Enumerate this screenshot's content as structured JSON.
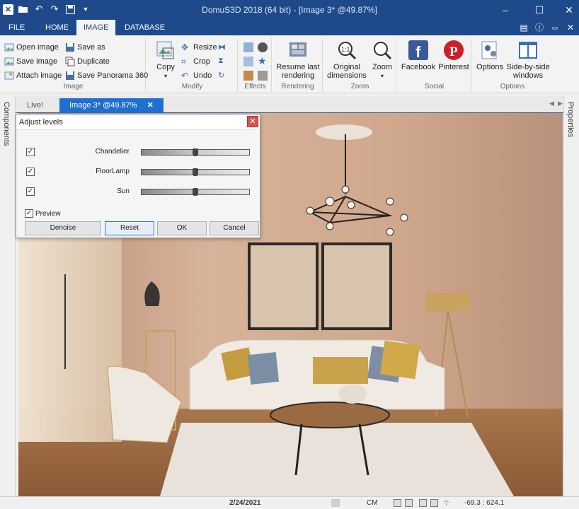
{
  "window": {
    "title": "DomuS3D 2018 (64 bit) - [Image 3* @49.87%]"
  },
  "ribbon_tabs": [
    {
      "label": "FILE"
    },
    {
      "label": "HOME"
    },
    {
      "label": "IMAGE"
    },
    {
      "label": "DATABASE"
    }
  ],
  "ribbon": {
    "image_group": {
      "label": "Image",
      "open_image": "Open image",
      "save_image": "Save image",
      "attach_image": "Attach image",
      "save_as": "Save as",
      "duplicate": "Duplicate",
      "save_panorama": "Save Panorama 360"
    },
    "modify_group": {
      "label": "Modify",
      "copy": "Copy",
      "resize": "Resize",
      "crop": "Crop",
      "undo": "Undo"
    },
    "effects_group": {
      "label": "Effects"
    },
    "rendering_group": {
      "label": "Rendering",
      "resume": "Resume last rendering"
    },
    "zoom_group": {
      "label": "Zoom",
      "original": "Original dimensions",
      "zoom": "Zoom"
    },
    "social_group": {
      "label": "Social",
      "facebook": "Facebook",
      "pinterest": "Pinterest"
    },
    "options_group": {
      "label": "Options",
      "options": "Options",
      "side_by_side": "Side-by-side windows"
    }
  },
  "side_panels": {
    "left": "Components",
    "right": "Properties"
  },
  "doc_tabs": [
    {
      "label": "Live!"
    },
    {
      "label": "Image 3* @49.87%"
    }
  ],
  "dialog": {
    "title": "Adjust levels",
    "lights": [
      {
        "name": "Chandelier",
        "checked": true,
        "level": 0.5
      },
      {
        "name": "FloorLamp",
        "checked": true,
        "level": 0.5
      },
      {
        "name": "Sun",
        "checked": true,
        "level": 0.5
      }
    ],
    "preview_label": "Preview",
    "preview_checked": true,
    "buttons": {
      "denoise": "Denoise",
      "reset": "Reset",
      "ok": "OK",
      "cancel": "Cancel"
    }
  },
  "statusbar": {
    "date": "2/24/2021",
    "unit": "CM",
    "coords": "-69.3 : 624.1"
  },
  "colors": {
    "title_bar": "#1e4a8c",
    "active_doc_tab": "#1e6fd0",
    "wall": "#c9a58b"
  }
}
